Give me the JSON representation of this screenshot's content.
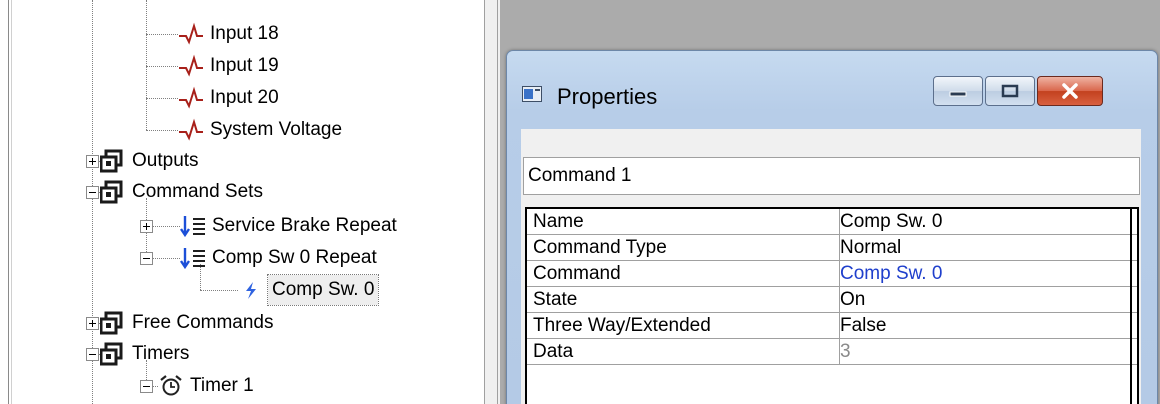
{
  "tree": {
    "nodes": [
      {
        "label": "Input 18",
        "icon": "waveform-icon"
      },
      {
        "label": "Input 19",
        "icon": "waveform-icon"
      },
      {
        "label": "Input 20",
        "icon": "waveform-icon"
      },
      {
        "label": "System Voltage",
        "icon": "waveform-icon"
      },
      {
        "label": "Outputs",
        "icon": "group-icon",
        "expander": "plus"
      },
      {
        "label": "Command Sets",
        "icon": "group-icon",
        "expander": "minus"
      },
      {
        "label": "Service Brake Repeat",
        "icon": "command-list-icon",
        "expander": "plus"
      },
      {
        "label": "Comp Sw 0 Repeat",
        "icon": "command-list-icon",
        "expander": "minus"
      },
      {
        "label": "Comp Sw. 0",
        "icon": "lightning-icon",
        "selected": true
      },
      {
        "label": "Free Commands",
        "icon": "group-icon",
        "expander": "plus"
      },
      {
        "label": "Timers",
        "icon": "group-icon",
        "expander": "minus"
      },
      {
        "label": "Timer 1",
        "icon": "alarm-clock-icon",
        "expander": "minus"
      }
    ]
  },
  "properties": {
    "title": "Properties",
    "selected_object": "Command 1",
    "rows": [
      {
        "name": "Name",
        "value": "Comp Sw. 0",
        "value_color": "#000000"
      },
      {
        "name": "Command Type",
        "value": "Normal",
        "value_color": "#000000"
      },
      {
        "name": "Command",
        "value": "Comp Sw. 0",
        "value_color": "#1f3fcc"
      },
      {
        "name": "State",
        "value": "On",
        "value_color": "#000000"
      },
      {
        "name": "Three Way/Extended",
        "value": "False",
        "value_color": "#000000"
      },
      {
        "name": "Data",
        "value": "3",
        "value_color": "#8a8a8a"
      }
    ]
  },
  "colors": {
    "waveform": "#a8201a",
    "group_icon": "#1a1a1a",
    "command_arrow": "#1c4fd8",
    "lightning": "#2f63e0",
    "workspace": "#ababab"
  }
}
